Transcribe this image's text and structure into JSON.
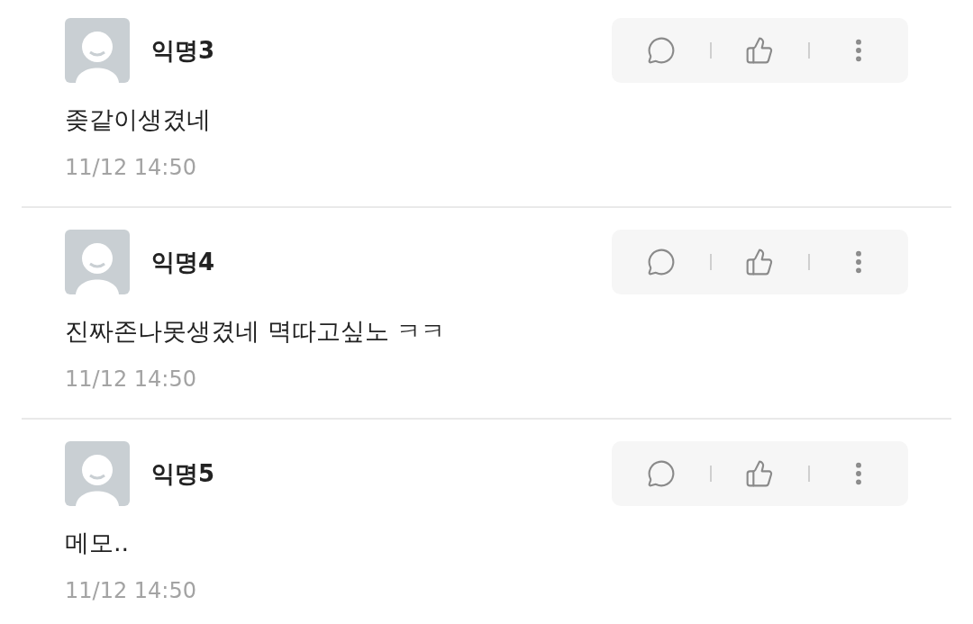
{
  "comments": [
    {
      "author": "익명3",
      "text": "좆같이생겼네",
      "time": "11/12 14:50"
    },
    {
      "author": "익명4",
      "text": "진짜존나못생겼네 멱따고싶노 ㅋㅋ",
      "time": "11/12 14:50"
    },
    {
      "author": "익명5",
      "text": "메모..",
      "time": "11/12 14:50"
    }
  ]
}
